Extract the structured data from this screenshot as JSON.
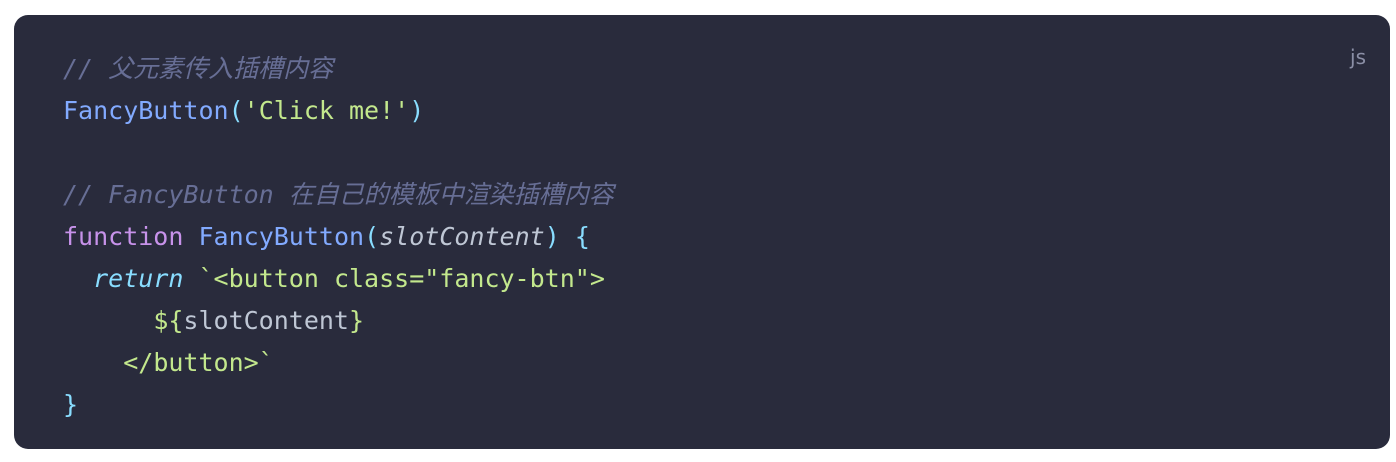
{
  "code_block": {
    "language": "js",
    "lines": [
      {
        "comment": "// 父元素传入插槽内容"
      },
      {
        "fn": "FancyButton",
        "open": "(",
        "str": "'Click me!'",
        "close": ")"
      },
      {},
      {
        "comment": "// FancyButton 在自己的模板中渲染插槽内容"
      },
      {
        "kw": "function",
        "fn": "FancyButton",
        "open": "(",
        "param": "slotContent",
        "close": ")",
        "brace": "{"
      },
      {
        "indent": "  ",
        "kw": "return",
        "str": "`<button class=\"fancy-btn\">"
      },
      {
        "indent": "      ",
        "interp_open": "${",
        "expr": "slotContent",
        "interp_close": "}"
      },
      {
        "indent": "    ",
        "str": "</button>`"
      },
      {
        "brace": "}"
      }
    ]
  },
  "colors": {
    "background": "#292b3c",
    "comment": "#676e95",
    "function": "#82aaff",
    "string": "#c3e88d",
    "keyword": "#c792ea",
    "punctuation": "#89ddff",
    "text": "#bfc7d5"
  }
}
